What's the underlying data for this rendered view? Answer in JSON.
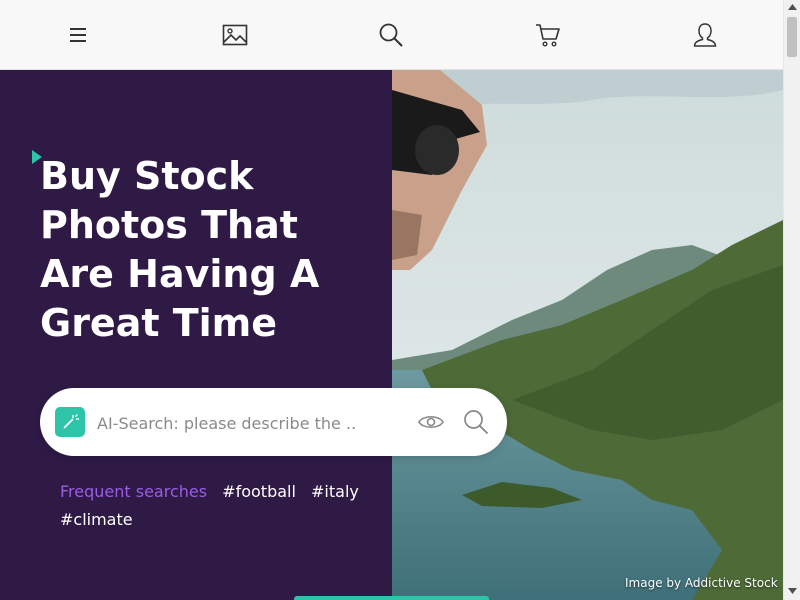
{
  "nav": {
    "icons": [
      "menu-icon",
      "image-icon",
      "search-icon",
      "cart-icon",
      "user-icon"
    ]
  },
  "hero": {
    "headline": "Buy Stock Photos That Are Having A Great Time",
    "search": {
      "placeholder": "AI-Search: please describe the ..."
    },
    "frequent_label": "Frequent searches",
    "tags": [
      "#football",
      "#italy",
      "#climate"
    ],
    "image_credit": "Image by Addictive Stock"
  },
  "colors": {
    "hero_bg": "#2e1a45",
    "accent_teal": "#2dc4a8",
    "frequent_label": "#9b5de5"
  }
}
